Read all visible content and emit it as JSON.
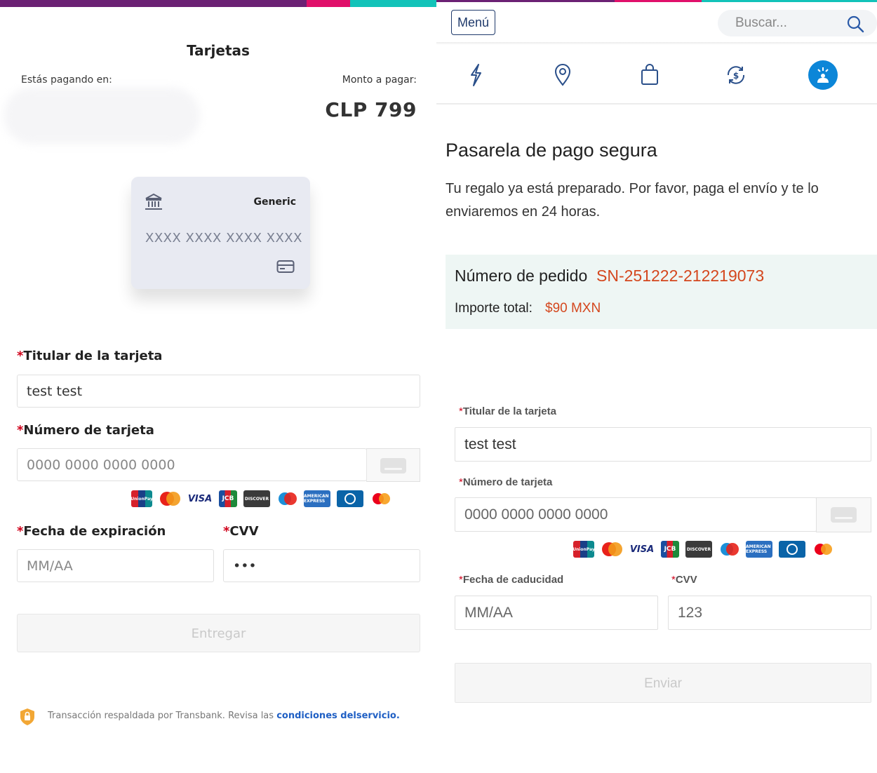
{
  "colors": {
    "accent_purple": "#6b2174",
    "accent_pink": "#e0106a",
    "accent_teal": "#12c3b9",
    "error": "#d0021b",
    "link": "#1f5fc4",
    "order_orange": "#d4471e",
    "nav_active": "#0c86d8"
  },
  "left": {
    "title": "Tarjetas",
    "paying_at_label": "Estás pagando en:",
    "amount_label": "Monto a pagar:",
    "amount": "CLP 799",
    "card_preview": {
      "brand": "Generic",
      "number_mask": "XXXX XXXX XXXX XXXX",
      "bank_icon": "bank-icon",
      "card_icon": "credit-card-icon"
    },
    "required_mark": "*",
    "holder_label": "Titular de la tarjeta",
    "holder_value": "test test",
    "number_label": "Número de tarjeta",
    "number_placeholder": "0000 0000 0000 0000",
    "expiry_label": "Fecha de expiración",
    "expiry_placeholder": "MM/AA",
    "cvv_label": "CVV",
    "cvv_value": "•••",
    "submit_label": "Entregar",
    "footer_text": "Transacción respaldada por Transbank. Revisa las ",
    "footer_link": "condiciones delservicio."
  },
  "right": {
    "menu_label": "Menú",
    "search_placeholder": "Buscar...",
    "nav_icons": [
      "lightning-icon",
      "location-pin-icon",
      "shopping-bag-icon",
      "money-exchange-icon",
      "gift-icon"
    ],
    "title": "Pasarela de pago segura",
    "description": "Tu regalo ya está preparado. Por favor, paga el envío y te lo enviaremos en 24 horas.",
    "order_label": "Número de pedido",
    "order_number": "SN-251222-212219073",
    "total_label": "Importe total:",
    "total_value": "$90 MXN",
    "required_mark": "*",
    "holder_label": "Titular de la tarjeta",
    "holder_value": "test test",
    "number_label": "Número de tarjeta",
    "number_placeholder": "0000 0000 0000 0000",
    "expiry_label": "Fecha de caducidad",
    "expiry_placeholder": "MM/AA",
    "cvv_label": "CVV",
    "cvv_value": "123",
    "submit_label": "Enviar"
  },
  "brands": {
    "unionpay": "UnionPay",
    "mastercard_text": "MasterCard",
    "visa": "VISA",
    "jcb": "JCB",
    "discover": "DISCOVER",
    "maestro": "Maestro",
    "amex": "AMERICAN EXPRESS",
    "diners": "Diners Club",
    "mastercard": "Mastercard"
  }
}
